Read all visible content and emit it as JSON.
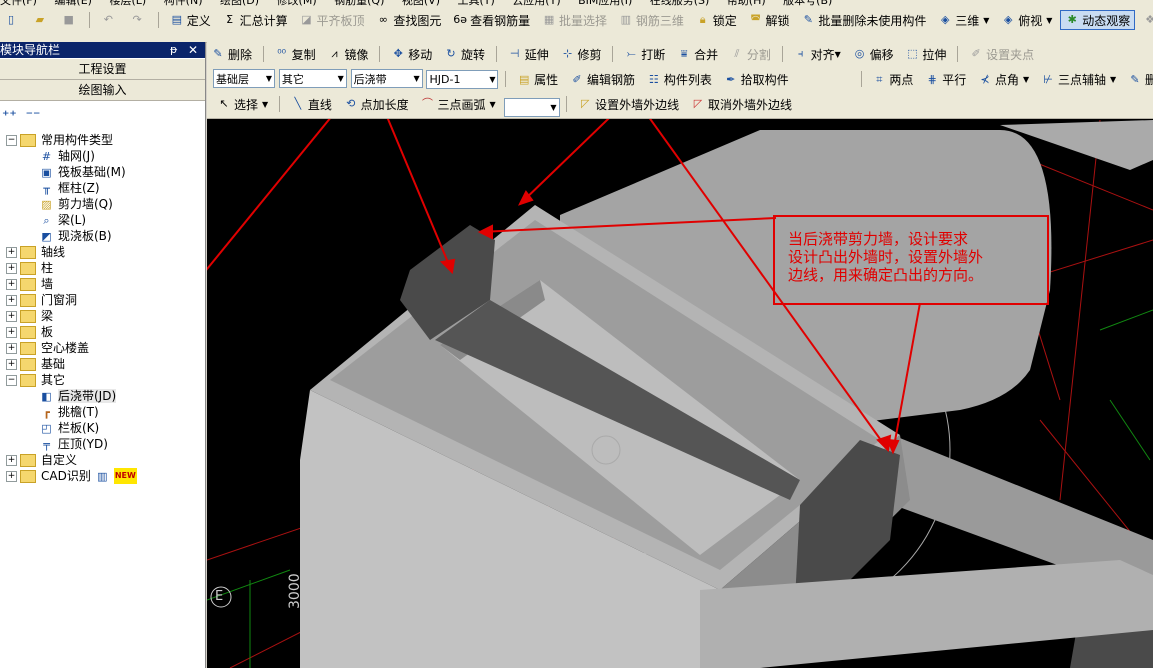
{
  "menu": [
    "文件(F)",
    "编辑(E)",
    "楼层(L)",
    "构件(N)",
    "绘图(D)",
    "修改(M)",
    "钢筋量(Q)",
    "视图(V)",
    "工具(T)",
    "云应用(Y)",
    "BIM应用(I)",
    "在线服务(S)",
    "帮助(H)",
    "版本号(B)"
  ],
  "toolbar1": {
    "define": "定义",
    "summary": "汇总计算",
    "align_slab_top": "平齐板顶",
    "find_element": "查找图元",
    "view_rebar": "查看钢筋量",
    "batch_select": "批量选择",
    "rebar_3d": "钢筋三维",
    "lock": "锁定",
    "unlock": "解锁",
    "batch_delete_unused": "批量删除未使用构件",
    "view_3d": "三维",
    "top_view": "俯视",
    "dynamic_observe": "动态观察",
    "local": "局部"
  },
  "navigator": {
    "title": "模块导航栏",
    "project_settings": "工程设置",
    "drawing_input": "绘图输入",
    "tree": {
      "common": "常用构件类型",
      "common_children": [
        "轴网(J)",
        "筏板基础(M)",
        "框柱(Z)",
        "剪力墙(Q)",
        "梁(L)",
        "现浇板(B)"
      ],
      "axis": "轴线",
      "column": "柱",
      "wall": "墙",
      "door_window": "门窗洞",
      "beam": "梁",
      "slab": "板",
      "hollow_floor": "空心楼盖",
      "foundation": "基础",
      "other": "其它",
      "other_children": [
        "后浇带(JD)",
        "挑檐(T)",
        "栏板(K)",
        "压顶(YD)"
      ],
      "custom": "自定义",
      "cad": "CAD识别",
      "new_badge": "NEW"
    }
  },
  "toolbar2": {
    "delete": "删除",
    "copy": "复制",
    "mirror": "镜像",
    "move": "移动",
    "rotate": "旋转",
    "extend": "延伸",
    "trim": "修剪",
    "break": "打断",
    "merge": "合并",
    "split": "分割",
    "align": "对齐",
    "offset": "偏移",
    "stretch": "拉伸",
    "set_grip": "设置夹点"
  },
  "toolbar3": {
    "floor": "基础层",
    "category": "其它",
    "element_type": "后浇带",
    "element_name": "HJD-1",
    "property": "属性",
    "edit_rebar": "编辑钢筋",
    "element_list": "构件列表",
    "pick_element": "拾取构件",
    "two_points": "两点",
    "parallel": "平行",
    "point_angle": "点角",
    "three_point_axis": "三点辅轴",
    "delete2": "删除"
  },
  "toolbar4": {
    "select": "选择",
    "line": "直线",
    "point_add_length": "点加长度",
    "three_point_arc": "三点画弧",
    "set_outer_edge": "设置外墙外边线",
    "cancel_outer_edge": "取消外墙外边线"
  },
  "viewport": {
    "callout": "当后浇带剪力墙，设计要求\n设计凸出外墙时，设置外墙外\n边线，用来确定凸出的方向。",
    "axis_label": "E",
    "dimension": "3000"
  },
  "colors": {
    "annotation_red": "#e00000",
    "title_bar": "#0a246a",
    "viewport_bg": "#000000"
  }
}
